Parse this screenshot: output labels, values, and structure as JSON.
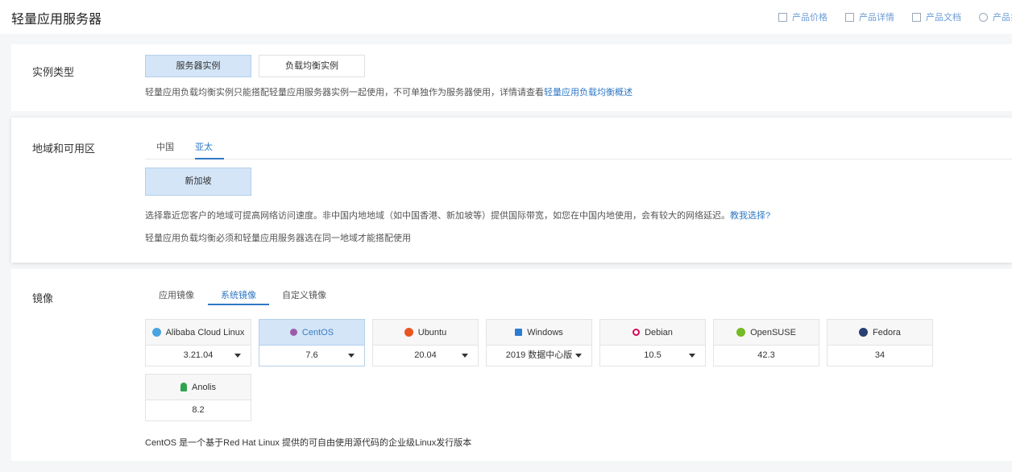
{
  "header": {
    "title": "轻量应用服务器",
    "links": [
      "产品价格",
      "产品详情",
      "产品文档",
      "产品扌"
    ]
  },
  "instance_type": {
    "label": "实例类型",
    "options": [
      "服务器实例",
      "负载均衡实例"
    ],
    "selected": "服务器实例",
    "hint": "轻量应用负载均衡实例只能搭配轻量应用服务器实例一起使用，不可单独作为服务器使用，详情请查看",
    "hint_link": "轻量应用负载均衡概述"
  },
  "region": {
    "label": "地域和可用区",
    "tabs": [
      "中国",
      "亚太"
    ],
    "active_tab": "亚太",
    "selected_region": "新加坡",
    "hint1": "选择靠近您客户的地域可提高网络访问速度。非中国内地地域（如中国香港、新加坡等）提供国际带宽，如您在中国内地使用，会有较大的网络延迟。",
    "hint1_link": "教我选择?",
    "hint2": "轻量应用负载均衡必须和轻量应用服务器选在同一地域才能搭配使用"
  },
  "image": {
    "label": "镜像",
    "tabs": [
      "应用镜像",
      "系统镜像",
      "自定义镜像"
    ],
    "active_tab": "系统镜像",
    "os_list": [
      {
        "name": "Alibaba Cloud Linux",
        "version": "3.21.04",
        "icon": "alibaba-cloud-icon",
        "color": "#4aa3df"
      },
      {
        "name": "CentOS",
        "version": "7.6",
        "icon": "centos-icon",
        "color": "#9c5ba8"
      },
      {
        "name": "Ubuntu",
        "version": "20.04",
        "icon": "ubuntu-icon",
        "color": "#e95420"
      },
      {
        "name": "Windows",
        "version": "2019 数据中心版",
        "icon": "windows-icon",
        "color": "#2b7cd3"
      },
      {
        "name": "Debian",
        "version": "10.5",
        "icon": "debian-icon",
        "color": "#d70a53"
      },
      {
        "name": "OpenSUSE",
        "version": "42.3",
        "icon": "opensuse-icon",
        "color": "#73ba25"
      },
      {
        "name": "Fedora",
        "version": "34",
        "icon": "fedora-icon",
        "color": "#294172"
      },
      {
        "name": "Anolis",
        "version": "8.2",
        "icon": "anolis-icon",
        "color": "#2ea44f"
      }
    ],
    "selected": "CentOS",
    "description": "CentOS 是一个基于Red Hat Linux 提供的可自由使用源代码的企业级Linux发行版本"
  }
}
